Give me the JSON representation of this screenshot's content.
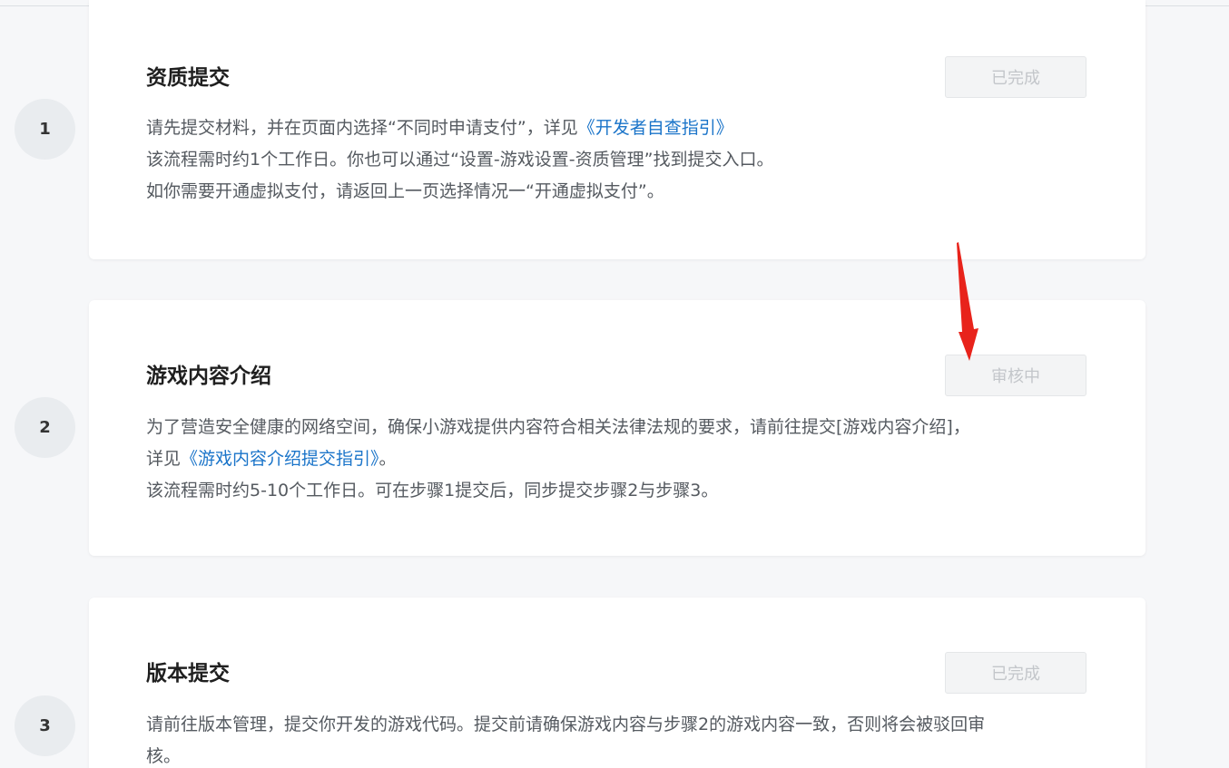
{
  "steps": [
    {
      "number": "1",
      "title": "资质提交",
      "status": "已完成",
      "lines": [
        {
          "text": "请先提交材料，并在页面内选择“不同时申请支付”，详见",
          "link": "《开发者自查指引》",
          "tail": ""
        },
        {
          "text": "该流程需时约1个工作日。你也可以通过“设置-游戏设置-资质管理”找到提交入口。",
          "link": "",
          "tail": ""
        },
        {
          "text": "如你需要开通虚拟支付，请返回上一页选择情况一“开通虚拟支付”。",
          "link": "",
          "tail": ""
        }
      ]
    },
    {
      "number": "2",
      "title": "游戏内容介绍",
      "status": "审核中",
      "lines": [
        {
          "text": "为了营造安全健康的网络空间，确保小游戏提供内容符合相关法律法规的要求，请前往提交[游戏内容介绍]，",
          "link": "",
          "tail": ""
        },
        {
          "text": "详见",
          "link": "《游戏内容介绍提交指引》",
          "tail": "。"
        },
        {
          "text": "该流程需时约5-10个工作日。可在步骤1提交后，同步提交步骤2与步骤3。",
          "link": "",
          "tail": ""
        }
      ]
    },
    {
      "number": "3",
      "title": "版本提交",
      "status": "已完成",
      "lines": [
        {
          "text": "请前往版本管理，提交你开发的游戏代码。提交前请确保游戏内容与步骤2的游戏内容一致，否则将会被驳回审",
          "link": "",
          "tail": ""
        },
        {
          "text": "核。",
          "link": "",
          "tail": ""
        }
      ]
    }
  ],
  "colors": {
    "link": "#1a74c9",
    "arrow": "#e8231b"
  }
}
